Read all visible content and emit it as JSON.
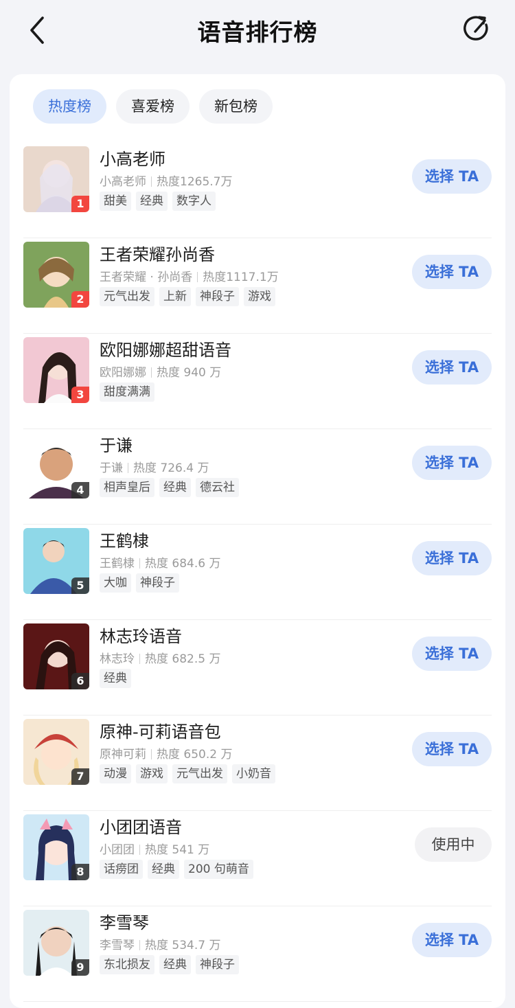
{
  "header": {
    "title": "语音排行榜"
  },
  "tabs": [
    {
      "label": "热度榜",
      "active": true
    },
    {
      "label": "喜爱榜",
      "active": false
    },
    {
      "label": "新包榜",
      "active": false
    }
  ],
  "colors": {
    "accent": "#3b70d9",
    "tab_active_bg": "#e1ebfc",
    "rank_top": "#f2463f"
  },
  "items": [
    {
      "rank": "1",
      "name": "小高老师",
      "source": "小高老师",
      "heat": "热度1265.7万",
      "tags": [
        "甜美",
        "经典",
        "数字人"
      ],
      "button": "选择 TA"
    },
    {
      "rank": "2",
      "name": "王者荣耀孙尚香",
      "source": "王者荣耀 · 孙尚香",
      "heat": "热度1117.1万",
      "tags": [
        "元气出发",
        "上新",
        "神段子",
        "游戏"
      ],
      "button": "选择 TA"
    },
    {
      "rank": "3",
      "name": "欧阳娜娜超甜语音",
      "source": "欧阳娜娜",
      "heat": "热度 940 万",
      "tags": [
        "甜度满满"
      ],
      "button": "选择 TA"
    },
    {
      "rank": "4",
      "name": "于谦",
      "source": "于谦",
      "heat": "热度 726.4 万",
      "tags": [
        "相声皇后",
        "经典",
        "德云社"
      ],
      "button": "选择 TA"
    },
    {
      "rank": "5",
      "name": "王鹤棣",
      "source": "王鹤棣",
      "heat": "热度 684.6 万",
      "tags": [
        "大咖",
        "神段子"
      ],
      "button": "选择 TA"
    },
    {
      "rank": "6",
      "name": "林志玲语音",
      "source": "林志玲",
      "heat": "热度 682.5 万",
      "tags": [
        "经典"
      ],
      "button": "选择 TA"
    },
    {
      "rank": "7",
      "name": "原神-可莉语音包",
      "source": "原神可莉",
      "heat": "热度 650.2 万",
      "tags": [
        "动漫",
        "游戏",
        "元气出发",
        "小奶音"
      ],
      "button": "选择 TA"
    },
    {
      "rank": "8",
      "name": "小团团语音",
      "source": "小团团",
      "heat": "热度 541 万",
      "tags": [
        "话痨团",
        "经典",
        "200 句萌音"
      ],
      "button": "使用中"
    },
    {
      "rank": "9",
      "name": "李雪琴",
      "source": "李雪琴",
      "heat": "热度 534.7 万",
      "tags": [
        "东北损友",
        "经典",
        "神段子"
      ],
      "button": "选择 TA"
    }
  ]
}
